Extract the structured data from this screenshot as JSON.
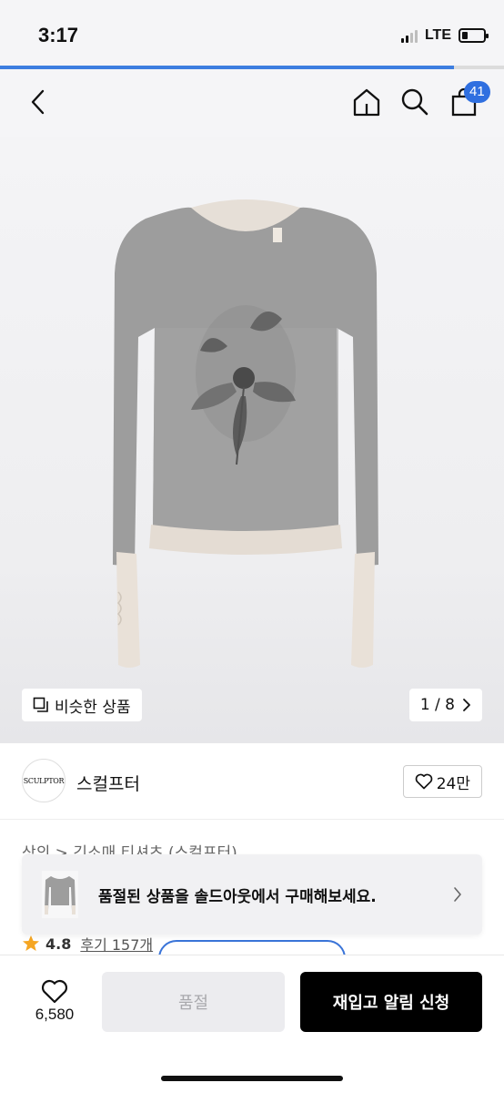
{
  "status_bar": {
    "time": "3:17",
    "network": "LTE",
    "battery_level": 0.25,
    "page_load_progress": 0.9
  },
  "header": {
    "back_icon": "chevron-left-icon",
    "home_icon": "home-icon",
    "search_icon": "search-icon",
    "cart_icon": "shopping-bag-icon",
    "cart_count": "41",
    "badge_color": "#2f6fe0"
  },
  "gallery": {
    "similar_label": "비슷한 상품",
    "similar_icon": "copy-icon",
    "pager_text": "1 / 8",
    "pager_icon": "chevron-right-icon"
  },
  "brand": {
    "logo_text": "SCULPTOR",
    "name": "스컬프터",
    "like_count": "24만",
    "like_icon": "heart-icon"
  },
  "breadcrumb": {
    "text": "상의 > 긴소매 티셔츠 (스컬프터)"
  },
  "soldout_banner": {
    "message": "품절된 상품을 솔드아웃에서 구매해보세요.",
    "chevron_icon": "chevron-right-icon"
  },
  "rating": {
    "star_icon": "star-icon",
    "value": "4.8",
    "review_link": "후기 157개"
  },
  "bottom_bar": {
    "wish_icon": "heart-icon",
    "wish_count": "6,580",
    "soldout_label": "품절",
    "notify_label": "재입고 알림 신청"
  },
  "colors": {
    "accent": "#2f6fe0",
    "primary_button": "#000000",
    "disabled_button": "#ececef"
  }
}
